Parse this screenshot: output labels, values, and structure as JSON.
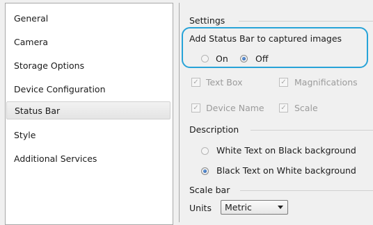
{
  "sidebar": {
    "items": [
      {
        "label": "General"
      },
      {
        "label": "Camera"
      },
      {
        "label": "Storage Options"
      },
      {
        "label": "Device Configuration"
      },
      {
        "label": "Status Bar",
        "selected": true
      },
      {
        "label": "Style"
      },
      {
        "label": "Additional Services"
      }
    ]
  },
  "settings": {
    "group_title": "Settings",
    "add_status_bar_label": "Add Status Bar to captured images",
    "on_label": "On",
    "off_label": "Off",
    "selected": "Off",
    "checkboxes": [
      {
        "label": "Text Box",
        "checked": true
      },
      {
        "label": "Magnifications",
        "checked": true
      },
      {
        "label": "Device Name",
        "checked": true
      },
      {
        "label": "Scale",
        "checked": true
      }
    ]
  },
  "description": {
    "group_title": "Description",
    "options": [
      {
        "label": "White Text on Black background",
        "selected": false
      },
      {
        "label": "Black Text on White background",
        "selected": true
      }
    ]
  },
  "scale_bar": {
    "group_title": "Scale bar",
    "units_label": "Units",
    "units_value": "Metric"
  },
  "colors": {
    "highlight": "#27a3d8",
    "radio_dot": "#1d4f9a"
  }
}
